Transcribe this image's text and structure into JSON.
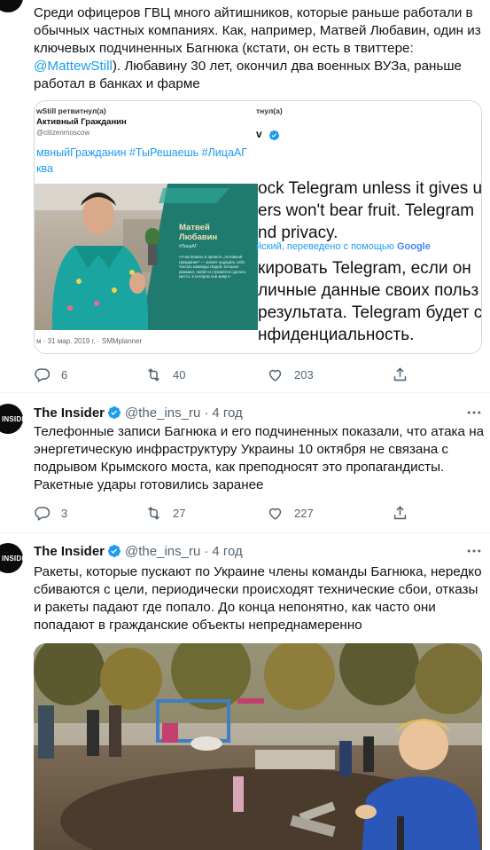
{
  "tweet1": {
    "text": "Среди офицеров ГВЦ много айтишников, которые раньше работали в обычных частных компаниях. Как, например, Матвей Любавин, один из ключевых подчиненных Багнюка (кстати, он есть в твиттере: ",
    "mention": "@MattewStill",
    "text_after": "). Любавину 30 лет, окончил два военных ВУЗа, раньше работал в банках и фарме",
    "image": {
      "left_retweet": "wStill ретвитнул(а)",
      "left_account": "Активный Гражданин",
      "left_handle": "@citizenmoscow",
      "left_hashtags_1": "мвныйГражданин #ТыРешаешь #ЛицаАГ",
      "left_hashtags_2": "ква",
      "card_name_1": "Матвей",
      "card_name_2": "Любавин",
      "card_tag": "#ЛицаАГ",
      "card_quote": "«Участвовать в проекте „Активный гражданин“ — значит ощущать себя частью команды людей, которые уважают, любят и стремятся сделать место, в котором они живут»",
      "left_footer": "м · 31 мар. 2019 г. · SMMplanner",
      "right_retweet": "тнул(а)",
      "right_en_1": "ock Telegram unless it gives u",
      "right_en_2": "ers won't bear fruit. Telegram",
      "right_en_3": "nd privacy.",
      "right_translated": "йский, переведено с помощью",
      "right_google": "Google",
      "right_ru_1": "кировать Telegram, если он",
      "right_ru_2": "личные данные своих польз",
      "right_ru_3": "результата. Telegram будет с",
      "right_ru_4": "нфиденциальность."
    },
    "replies": "6",
    "retweets": "40",
    "likes": "203"
  },
  "tweet2": {
    "name": "The Insider",
    "handle": "@the_ins_ru",
    "time": "4 год",
    "avatar_text": "INSIDER",
    "text": "Телефонные записи Багнюка и его подчиненных показали, что атака на энергетическую инфраструктуру Украины 10 октября не связана с подрывом Крымского моста, как преподносят это пропагандисты. Ракетные удары готовились заранее",
    "replies": "3",
    "retweets": "27",
    "likes": "227"
  },
  "tweet3": {
    "name": "The Insider",
    "handle": "@the_ins_ru",
    "time": "4 год",
    "avatar_text": "INSIDER",
    "text": "Ракеты, которые пускают по Украине члены команды Багнюка, нередко сбиваются с цели, периодически происходят технические сбои, отказы и ракеты падают где попало. До конца непонятно, как часто они попадают в гражданские объекты непреднамеренно"
  },
  "colors": {
    "accent": "#1d9bf0",
    "secondary_text": "#536471",
    "card_green": "#1f7b70"
  }
}
